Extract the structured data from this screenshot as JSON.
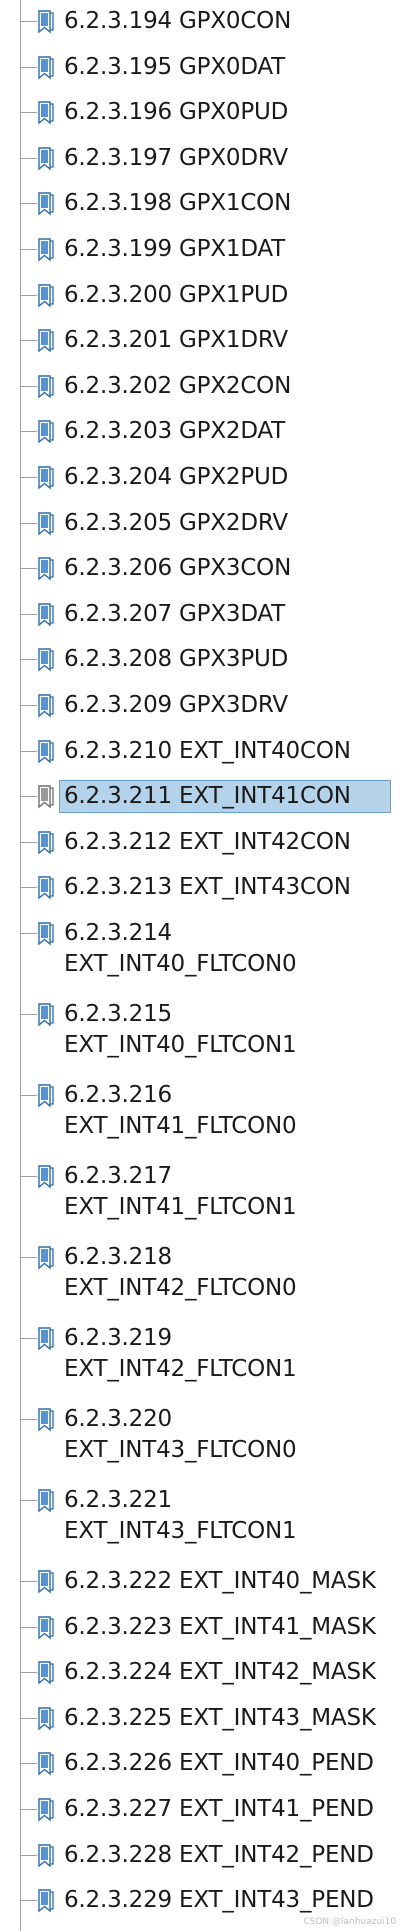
{
  "tree": {
    "items": [
      {
        "label": "6.2.3.194 GPX0CON"
      },
      {
        "label": "6.2.3.195 GPX0DAT"
      },
      {
        "label": "6.2.3.196 GPX0PUD"
      },
      {
        "label": "6.2.3.197 GPX0DRV"
      },
      {
        "label": "6.2.3.198 GPX1CON"
      },
      {
        "label": "6.2.3.199 GPX1DAT"
      },
      {
        "label": "6.2.3.200 GPX1PUD"
      },
      {
        "label": "6.2.3.201 GPX1DRV"
      },
      {
        "label": "6.2.3.202 GPX2CON"
      },
      {
        "label": "6.2.3.203 GPX2DAT"
      },
      {
        "label": "6.2.3.204 GPX2PUD"
      },
      {
        "label": "6.2.3.205 GPX2DRV"
      },
      {
        "label": "6.2.3.206 GPX3CON"
      },
      {
        "label": "6.2.3.207 GPX3DAT"
      },
      {
        "label": "6.2.3.208 GPX3PUD"
      },
      {
        "label": "6.2.3.209 GPX3DRV"
      },
      {
        "label": "6.2.3.210 EXT_INT40CON"
      },
      {
        "label": "6.2.3.211 EXT_INT41CON"
      },
      {
        "label": "6.2.3.212 EXT_INT42CON"
      },
      {
        "label": "6.2.3.213 EXT_INT43CON"
      },
      {
        "label": "6.2.3.214 EXT_INT40_FLTCON0"
      },
      {
        "label": "6.2.3.215 EXT_INT40_FLTCON1"
      },
      {
        "label": "6.2.3.216 EXT_INT41_FLTCON0"
      },
      {
        "label": "6.2.3.217 EXT_INT41_FLTCON1"
      },
      {
        "label": "6.2.3.218 EXT_INT42_FLTCON0"
      },
      {
        "label": "6.2.3.219 EXT_INT42_FLTCON1"
      },
      {
        "label": "6.2.3.220 EXT_INT43_FLTCON0"
      },
      {
        "label": "6.2.3.221 EXT_INT43_FLTCON1"
      },
      {
        "label": "6.2.3.222 EXT_INT40_MASK"
      },
      {
        "label": "6.2.3.223 EXT_INT41_MASK"
      },
      {
        "label": "6.2.3.224 EXT_INT42_MASK"
      },
      {
        "label": "6.2.3.225 EXT_INT43_MASK"
      },
      {
        "label": "6.2.3.226 EXT_INT40_PEND"
      },
      {
        "label": "6.2.3.227 EXT_INT41_PEND"
      },
      {
        "label": "6.2.3.228 EXT_INT42_PEND"
      },
      {
        "label": "6.2.3.229 EXT_INT43_PEND"
      }
    ],
    "selected_label": "6.2.3.211 EXT_INT41CON",
    "icon": "bookmark-page-icon"
  },
  "watermark": "CSDN @lanhuazui10",
  "colors": {
    "selection_bg": "#b4d2ea",
    "selection_border": "#6c9ec6",
    "tree_line": "#a0a0a0",
    "icon_blue": "#2b6cb0"
  }
}
